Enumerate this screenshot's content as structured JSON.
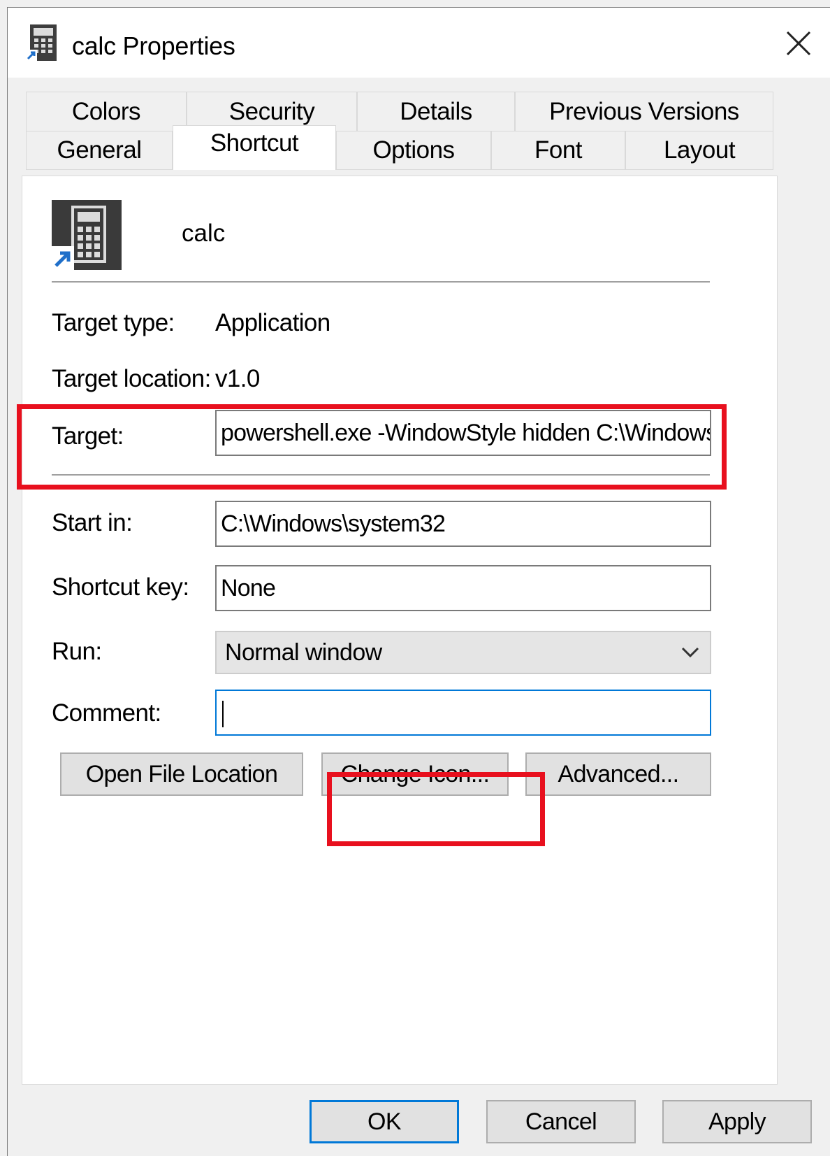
{
  "window": {
    "title": "calc Properties",
    "close_icon": "close-icon",
    "title_icon": "calculator-shortcut-icon"
  },
  "tabs": {
    "row1": [
      "Colors",
      "Security",
      "Details",
      "Previous Versions"
    ],
    "row2": [
      "General",
      "Shortcut",
      "Options",
      "Font",
      "Layout"
    ],
    "active": "Shortcut"
  },
  "shortcut": {
    "name": "calc",
    "icon": "calculator-shortcut-icon",
    "target_type_label": "Target type:",
    "target_type_value": "Application",
    "target_location_label": "Target location:",
    "target_location_value": "v1.0",
    "target_label": "Target:",
    "target_value": "powershell.exe -WindowStyle hidden C:\\Windows",
    "start_in_label": "Start in:",
    "start_in_value": "C:\\Windows\\system32",
    "shortcut_key_label": "Shortcut key:",
    "shortcut_key_value": "None",
    "run_label": "Run:",
    "run_value": "Normal window",
    "comment_label": "Comment:",
    "comment_value": ""
  },
  "buttons": {
    "open_file_location": "Open File Location",
    "change_icon": "Change Icon...",
    "advanced": "Advanced...",
    "ok": "OK",
    "cancel": "Cancel",
    "apply": "Apply"
  },
  "colors": {
    "highlight": "#e8101e",
    "focus": "#0078d7"
  }
}
